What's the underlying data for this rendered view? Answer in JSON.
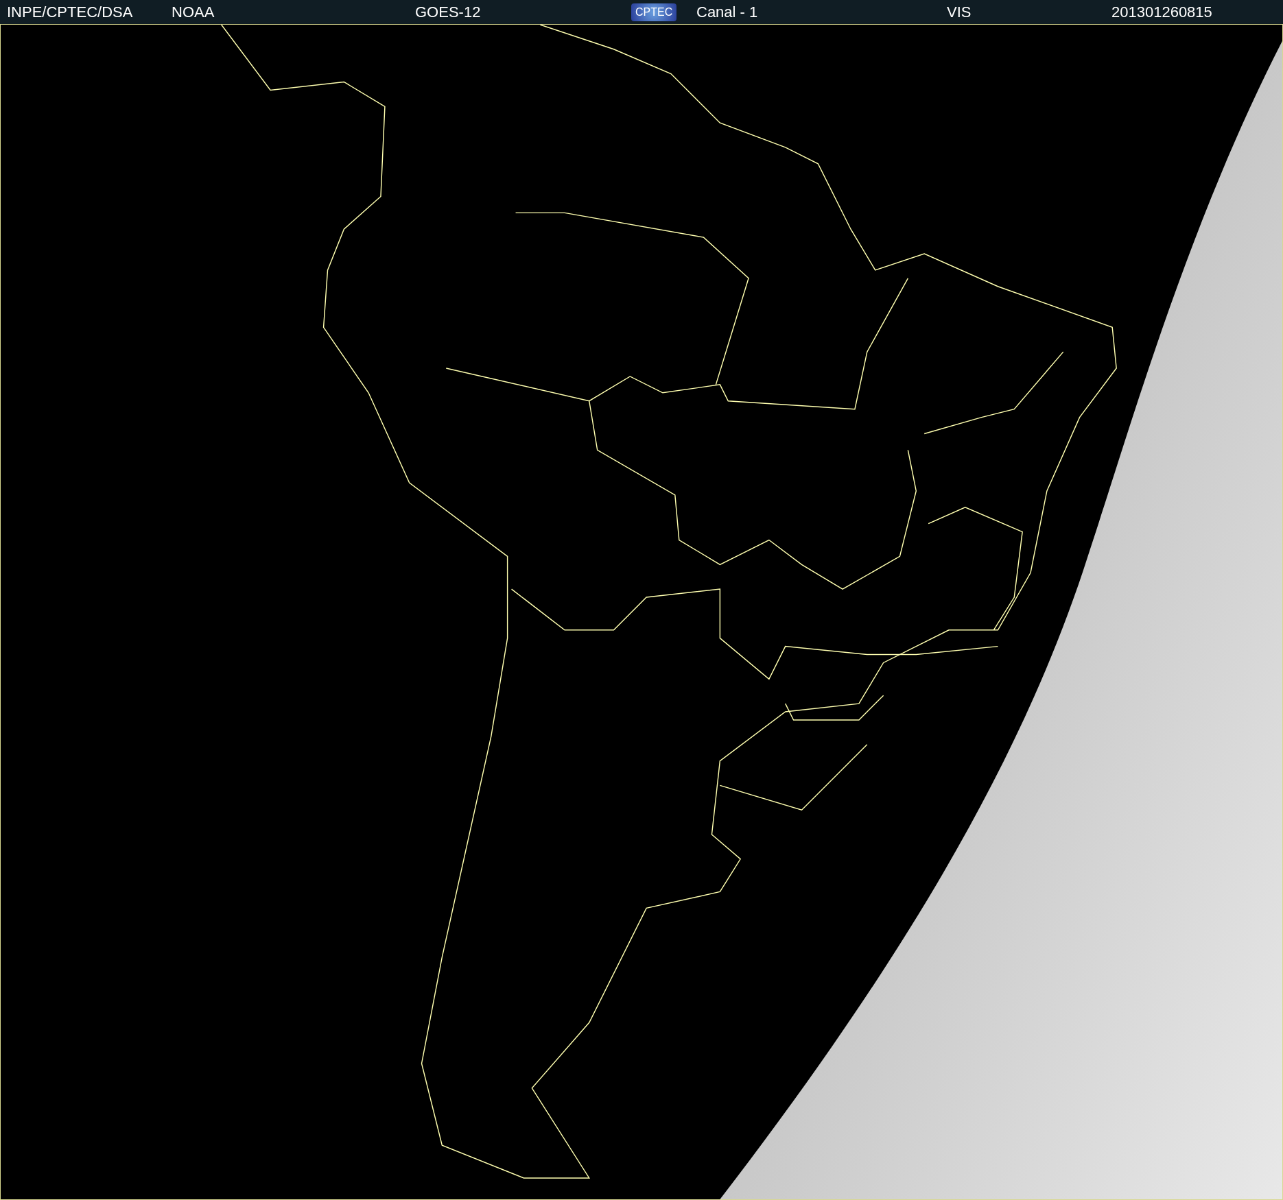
{
  "header": {
    "items": [
      {
        "kind": "text",
        "text": "INPE/CPTEC/DSA"
      },
      {
        "kind": "text",
        "text": "NOAA"
      },
      {
        "kind": "text",
        "text": "GOES-12"
      },
      {
        "kind": "logo",
        "text": "CPTEC"
      },
      {
        "kind": "text",
        "text": "Canal - 1"
      },
      {
        "kind": "text",
        "text": "VIS"
      },
      {
        "kind": "text",
        "text": "201301260815"
      }
    ]
  }
}
